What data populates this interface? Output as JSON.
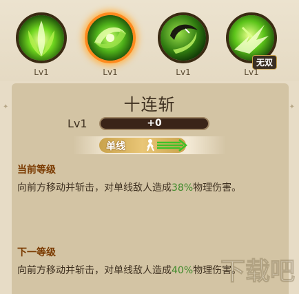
{
  "skills": [
    {
      "icon": "green-vortex-icon",
      "level": "Lv1",
      "selected": false
    },
    {
      "icon": "green-swirl-icon",
      "level": "Lv1",
      "selected": true
    },
    {
      "icon": "green-crescent-slash-icon",
      "level": "Lv1",
      "selected": false
    },
    {
      "icon": "green-burst-icon",
      "level": "Lv1",
      "selected": false,
      "badge": "无双"
    }
  ],
  "detail": {
    "name": "十连斩",
    "level_label": "Lv1",
    "exp_text": "+0",
    "target_type": "单线",
    "current_level_title": "当前等级",
    "current_desc_pre": "向前方移动并斩击，对单线敌人造成",
    "current_pct": "38%",
    "current_desc_post": "物理伤害。",
    "next_level_title": "下一等级",
    "next_desc_pre": "向前方移动并斩击，对单线敌人造成",
    "next_pct": "40%",
    "next_desc_post": "物理伤害。"
  },
  "colors": {
    "accent_green": "#3f8a2a",
    "title_brown": "#7a3a00",
    "selected_ring": "#ff8a1e"
  },
  "watermark": "下载吧"
}
